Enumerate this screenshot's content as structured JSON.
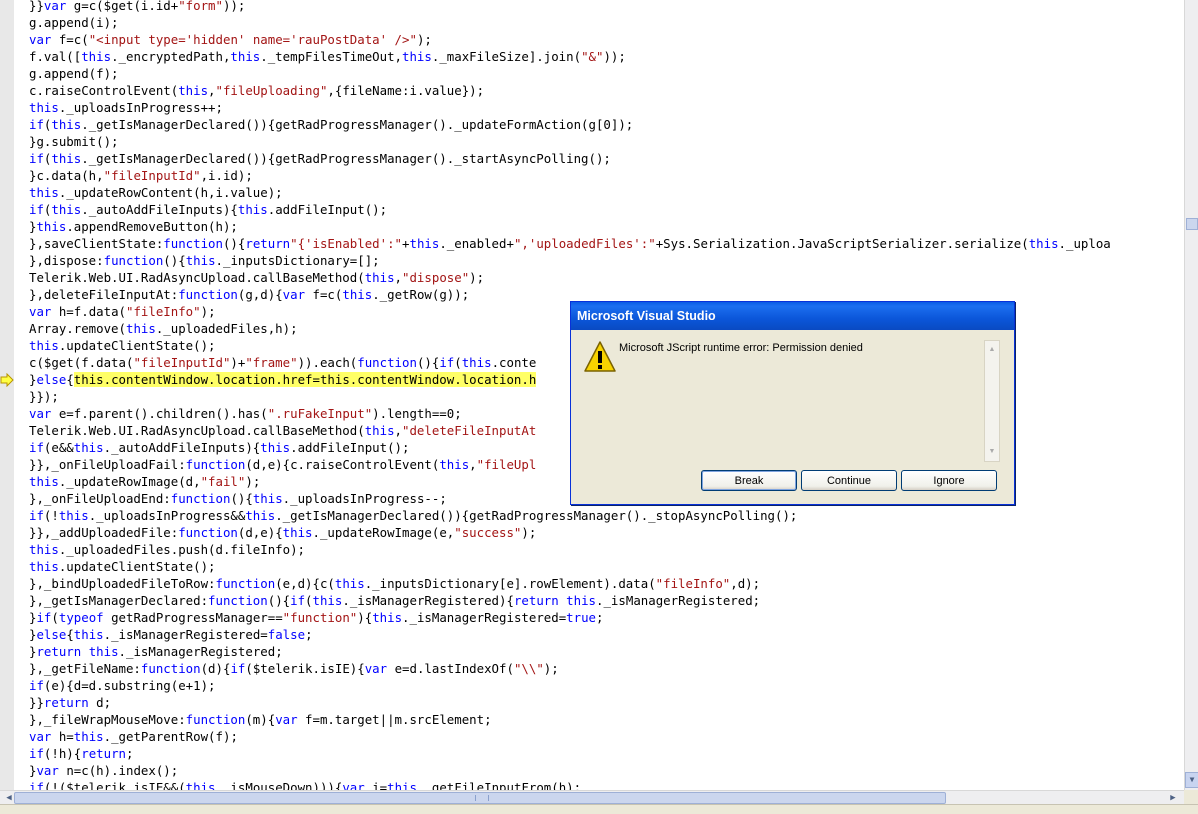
{
  "editor": {
    "lines": [
      [
        {
          "t": "}}"
        },
        {
          "t": "var",
          "c": "kw"
        },
        {
          "t": " g=c($get(i.id+"
        },
        {
          "t": "\"form\"",
          "c": "str"
        },
        {
          "t": "));"
        }
      ],
      [
        {
          "t": "g.append(i);"
        }
      ],
      [
        {
          "t": "var",
          "c": "kw"
        },
        {
          "t": " f=c("
        },
        {
          "t": "\"<input type='hidden' name='rauPostData' />\"",
          "c": "str"
        },
        {
          "t": ");"
        }
      ],
      [
        {
          "t": "f.val(["
        },
        {
          "t": "this",
          "c": "kw"
        },
        {
          "t": "._encryptedPath,"
        },
        {
          "t": "this",
          "c": "kw"
        },
        {
          "t": "._tempFilesTimeOut,"
        },
        {
          "t": "this",
          "c": "kw"
        },
        {
          "t": "._maxFileSize].join("
        },
        {
          "t": "\"&\"",
          "c": "str"
        },
        {
          "t": "));"
        }
      ],
      [
        {
          "t": "g.append(f);"
        }
      ],
      [
        {
          "t": "c.raiseControlEvent("
        },
        {
          "t": "this",
          "c": "kw"
        },
        {
          "t": ","
        },
        {
          "t": "\"fileUploading\"",
          "c": "str"
        },
        {
          "t": ",{fileName:i.value});"
        }
      ],
      [
        {
          "t": "this",
          "c": "kw"
        },
        {
          "t": "._uploadsInProgress++;"
        }
      ],
      [
        {
          "t": "if",
          "c": "kw"
        },
        {
          "t": "("
        },
        {
          "t": "this",
          "c": "kw"
        },
        {
          "t": "._getIsManagerDeclared()){getRadProgressManager()._updateFormAction(g[0]);"
        }
      ],
      [
        {
          "t": "}g.submit();"
        }
      ],
      [
        {
          "t": "if",
          "c": "kw"
        },
        {
          "t": "("
        },
        {
          "t": "this",
          "c": "kw"
        },
        {
          "t": "._getIsManagerDeclared()){getRadProgressManager()._startAsyncPolling();"
        }
      ],
      [
        {
          "t": "}c.data(h,"
        },
        {
          "t": "\"fileInputId\"",
          "c": "str"
        },
        {
          "t": ",i.id);"
        }
      ],
      [
        {
          "t": "this",
          "c": "kw"
        },
        {
          "t": "._updateRowContent(h,i.value);"
        }
      ],
      [
        {
          "t": "if",
          "c": "kw"
        },
        {
          "t": "("
        },
        {
          "t": "this",
          "c": "kw"
        },
        {
          "t": "._autoAddFileInputs){"
        },
        {
          "t": "this",
          "c": "kw"
        },
        {
          "t": ".addFileInput();"
        }
      ],
      [
        {
          "t": "}"
        },
        {
          "t": "this",
          "c": "kw"
        },
        {
          "t": ".appendRemoveButton(h);"
        }
      ],
      [
        {
          "t": "},saveClientState:"
        },
        {
          "t": "function",
          "c": "kw"
        },
        {
          "t": "(){"
        },
        {
          "t": "return",
          "c": "kw"
        },
        {
          "t": "\"{'isEnabled':\"",
          "c": "str"
        },
        {
          "t": "+"
        },
        {
          "t": "this",
          "c": "kw"
        },
        {
          "t": "._enabled+"
        },
        {
          "t": "\",'uploadedFiles':\"",
          "c": "str"
        },
        {
          "t": "+Sys.Serialization.JavaScriptSerializer.serialize("
        },
        {
          "t": "this",
          "c": "kw"
        },
        {
          "t": "._uploa"
        }
      ],
      [
        {
          "t": "},dispose:"
        },
        {
          "t": "function",
          "c": "kw"
        },
        {
          "t": "(){"
        },
        {
          "t": "this",
          "c": "kw"
        },
        {
          "t": "._inputsDictionary=[];"
        }
      ],
      [
        {
          "t": "Telerik.Web.UI.RadAsyncUpload.callBaseMethod("
        },
        {
          "t": "this",
          "c": "kw"
        },
        {
          "t": ","
        },
        {
          "t": "\"dispose\"",
          "c": "str"
        },
        {
          "t": ");"
        }
      ],
      [
        {
          "t": "},deleteFileInputAt:"
        },
        {
          "t": "function",
          "c": "kw"
        },
        {
          "t": "(g,d){"
        },
        {
          "t": "var",
          "c": "kw"
        },
        {
          "t": " f=c("
        },
        {
          "t": "this",
          "c": "kw"
        },
        {
          "t": "._getRow(g));"
        }
      ],
      [
        {
          "t": "var",
          "c": "kw"
        },
        {
          "t": " h=f.data("
        },
        {
          "t": "\"fileInfo\"",
          "c": "str"
        },
        {
          "t": ");"
        }
      ],
      [
        {
          "t": "Array.remove("
        },
        {
          "t": "this",
          "c": "kw"
        },
        {
          "t": "._uploadedFiles,h);"
        }
      ],
      [
        {
          "t": "this",
          "c": "kw"
        },
        {
          "t": ".updateClientState();"
        }
      ],
      [
        {
          "t": "c($get(f.data("
        },
        {
          "t": "\"fileInputId\"",
          "c": "str"
        },
        {
          "t": ")+"
        },
        {
          "t": "\"frame\"",
          "c": "str"
        },
        {
          "t": ")).each("
        },
        {
          "t": "function",
          "c": "kw"
        },
        {
          "t": "(){"
        },
        {
          "t": "if",
          "c": "kw"
        },
        {
          "t": "("
        },
        {
          "t": "this",
          "c": "kw"
        },
        {
          "t": ".conte"
        }
      ],
      [
        {
          "t": "}"
        },
        {
          "t": "else",
          "c": "kw"
        },
        {
          "t": "{"
        },
        {
          "t": "this.contentWindow.location.href=this.contentWindow.location.h",
          "c": "hl"
        }
      ],
      [
        {
          "t": "}});"
        }
      ],
      [
        {
          "t": "var",
          "c": "kw"
        },
        {
          "t": " e=f.parent().children().has("
        },
        {
          "t": "\".ruFakeInput\"",
          "c": "str"
        },
        {
          "t": ").length==0;"
        }
      ],
      [
        {
          "t": "Telerik.Web.UI.RadAsyncUpload.callBaseMethod("
        },
        {
          "t": "this",
          "c": "kw"
        },
        {
          "t": ","
        },
        {
          "t": "\"deleteFileInputAt",
          "c": "str"
        }
      ],
      [
        {
          "t": "if",
          "c": "kw"
        },
        {
          "t": "(e&&"
        },
        {
          "t": "this",
          "c": "kw"
        },
        {
          "t": "._autoAddFileInputs){"
        },
        {
          "t": "this",
          "c": "kw"
        },
        {
          "t": ".addFileInput();"
        }
      ],
      [
        {
          "t": "}},_onFileUploadFail:"
        },
        {
          "t": "function",
          "c": "kw"
        },
        {
          "t": "(d,e){c.raiseControlEvent("
        },
        {
          "t": "this",
          "c": "kw"
        },
        {
          "t": ","
        },
        {
          "t": "\"fileUpl",
          "c": "str"
        }
      ],
      [
        {
          "t": "this",
          "c": "kw"
        },
        {
          "t": "._updateRowImage(d,"
        },
        {
          "t": "\"fail\"",
          "c": "str"
        },
        {
          "t": ");"
        }
      ],
      [
        {
          "t": "},_onFileUploadEnd:"
        },
        {
          "t": "function",
          "c": "kw"
        },
        {
          "t": "(){"
        },
        {
          "t": "this",
          "c": "kw"
        },
        {
          "t": "._uploadsInProgress--;"
        }
      ],
      [
        {
          "t": "if",
          "c": "kw"
        },
        {
          "t": "(!"
        },
        {
          "t": "this",
          "c": "kw"
        },
        {
          "t": "._uploadsInProgress&&"
        },
        {
          "t": "this",
          "c": "kw"
        },
        {
          "t": "._getIsManagerDeclared()){getRadProgressManager()._stopAsyncPolling();"
        }
      ],
      [
        {
          "t": "}},_addUploadedFile:"
        },
        {
          "t": "function",
          "c": "kw"
        },
        {
          "t": "(d,e){"
        },
        {
          "t": "this",
          "c": "kw"
        },
        {
          "t": "._updateRowImage(e,"
        },
        {
          "t": "\"success\"",
          "c": "str"
        },
        {
          "t": ");"
        }
      ],
      [
        {
          "t": "this",
          "c": "kw"
        },
        {
          "t": "._uploadedFiles.push(d.fileInfo);"
        }
      ],
      [
        {
          "t": "this",
          "c": "kw"
        },
        {
          "t": ".updateClientState();"
        }
      ],
      [
        {
          "t": "},_bindUploadedFileToRow:"
        },
        {
          "t": "function",
          "c": "kw"
        },
        {
          "t": "(e,d){c("
        },
        {
          "t": "this",
          "c": "kw"
        },
        {
          "t": "._inputsDictionary[e].rowElement).data("
        },
        {
          "t": "\"fileInfo\"",
          "c": "str"
        },
        {
          "t": ",d);"
        }
      ],
      [
        {
          "t": "},_getIsManagerDeclared:"
        },
        {
          "t": "function",
          "c": "kw"
        },
        {
          "t": "(){"
        },
        {
          "t": "if",
          "c": "kw"
        },
        {
          "t": "("
        },
        {
          "t": "this",
          "c": "kw"
        },
        {
          "t": "._isManagerRegistered){"
        },
        {
          "t": "return",
          "c": "kw"
        },
        {
          "t": " "
        },
        {
          "t": "this",
          "c": "kw"
        },
        {
          "t": "._isManagerRegistered;"
        }
      ],
      [
        {
          "t": "}"
        },
        {
          "t": "if",
          "c": "kw"
        },
        {
          "t": "("
        },
        {
          "t": "typeof",
          "c": "kw"
        },
        {
          "t": " getRadProgressManager=="
        },
        {
          "t": "\"function\"",
          "c": "str"
        },
        {
          "t": "){"
        },
        {
          "t": "this",
          "c": "kw"
        },
        {
          "t": "._isManagerRegistered="
        },
        {
          "t": "true",
          "c": "kw"
        },
        {
          "t": ";"
        }
      ],
      [
        {
          "t": "}"
        },
        {
          "t": "else",
          "c": "kw"
        },
        {
          "t": "{"
        },
        {
          "t": "this",
          "c": "kw"
        },
        {
          "t": "._isManagerRegistered="
        },
        {
          "t": "false",
          "c": "kw"
        },
        {
          "t": ";"
        }
      ],
      [
        {
          "t": "}"
        },
        {
          "t": "return",
          "c": "kw"
        },
        {
          "t": " "
        },
        {
          "t": "this",
          "c": "kw"
        },
        {
          "t": "._isManagerRegistered;"
        }
      ],
      [
        {
          "t": "},_getFileName:"
        },
        {
          "t": "function",
          "c": "kw"
        },
        {
          "t": "(d){"
        },
        {
          "t": "if",
          "c": "kw"
        },
        {
          "t": "($telerik.isIE){"
        },
        {
          "t": "var",
          "c": "kw"
        },
        {
          "t": " e=d.lastIndexOf("
        },
        {
          "t": "\"\\\\\"",
          "c": "str"
        },
        {
          "t": ");"
        }
      ],
      [
        {
          "t": "if",
          "c": "kw"
        },
        {
          "t": "(e){d=d.substring(e+1);"
        }
      ],
      [
        {
          "t": "}}"
        },
        {
          "t": "return",
          "c": "kw"
        },
        {
          "t": " d;"
        }
      ],
      [
        {
          "t": "},_fileWrapMouseMove:"
        },
        {
          "t": "function",
          "c": "kw"
        },
        {
          "t": "(m){"
        },
        {
          "t": "var",
          "c": "kw"
        },
        {
          "t": " f=m.target||m.srcElement;"
        }
      ],
      [
        {
          "t": "var",
          "c": "kw"
        },
        {
          "t": " h="
        },
        {
          "t": "this",
          "c": "kw"
        },
        {
          "t": "._getParentRow(f);"
        }
      ],
      [
        {
          "t": "if",
          "c": "kw"
        },
        {
          "t": "(!h){"
        },
        {
          "t": "return",
          "c": "kw"
        },
        {
          "t": ";"
        }
      ],
      [
        {
          "t": "}"
        },
        {
          "t": "var",
          "c": "kw"
        },
        {
          "t": " n=c(h).index();"
        }
      ],
      [
        {
          "t": "if",
          "c": "kw"
        },
        {
          "t": "(!($telerik.isIE&&("
        },
        {
          "t": "this",
          "c": "kw"
        },
        {
          "t": "._isMouseDown))){"
        },
        {
          "t": "var",
          "c": "kw"
        },
        {
          "t": " i="
        },
        {
          "t": "this",
          "c": "kw"
        },
        {
          "t": "._getFileInputFrom(h);"
        }
      ]
    ],
    "current_line_marker": "arrow-icon"
  },
  "dialog": {
    "title": "Microsoft Visual Studio",
    "message": "Microsoft JScript runtime error: Permission denied",
    "icon": "warning-icon",
    "buttons": {
      "break": "Break",
      "continue": "Continue",
      "ignore": "Ignore"
    }
  },
  "colors": {
    "keyword": "#0000ff",
    "string": "#a31515",
    "highlight": "#ffff66",
    "title_bar": "#0a5be6"
  }
}
